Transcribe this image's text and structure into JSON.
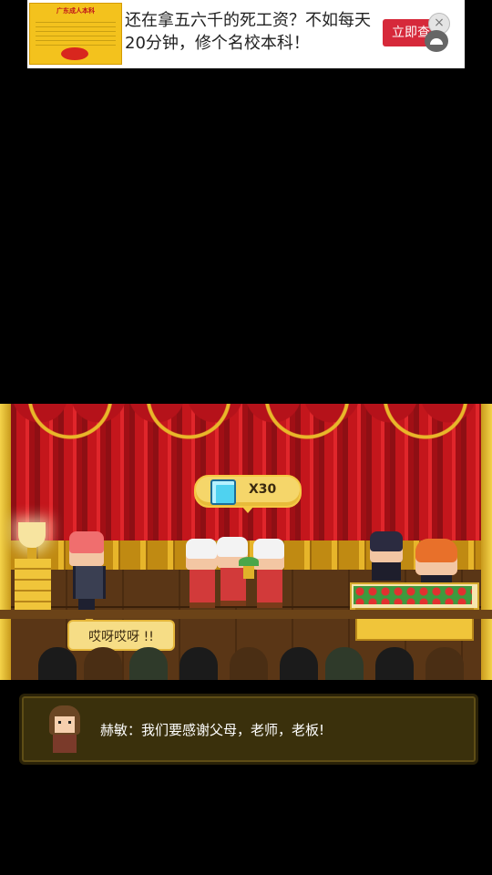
{
  "ad": {
    "thumb_title": "广东成人本科",
    "headline": "还在拿五六千的死工资？不如每天20分钟，修个名校本科！",
    "cta_label": "立即查看",
    "close_symbol": "×"
  },
  "scene": {
    "reward": {
      "icon": "diamond-icon",
      "amount_text": "X30"
    },
    "speech_bubble": "哎呀哎呀 !!",
    "colors": {
      "curtain": "#c4161c",
      "gold": "#f0c53a",
      "floor": "#5a3616"
    }
  },
  "dialog": {
    "text": "赫敏：我们要感谢父母，老师，老板!"
  }
}
